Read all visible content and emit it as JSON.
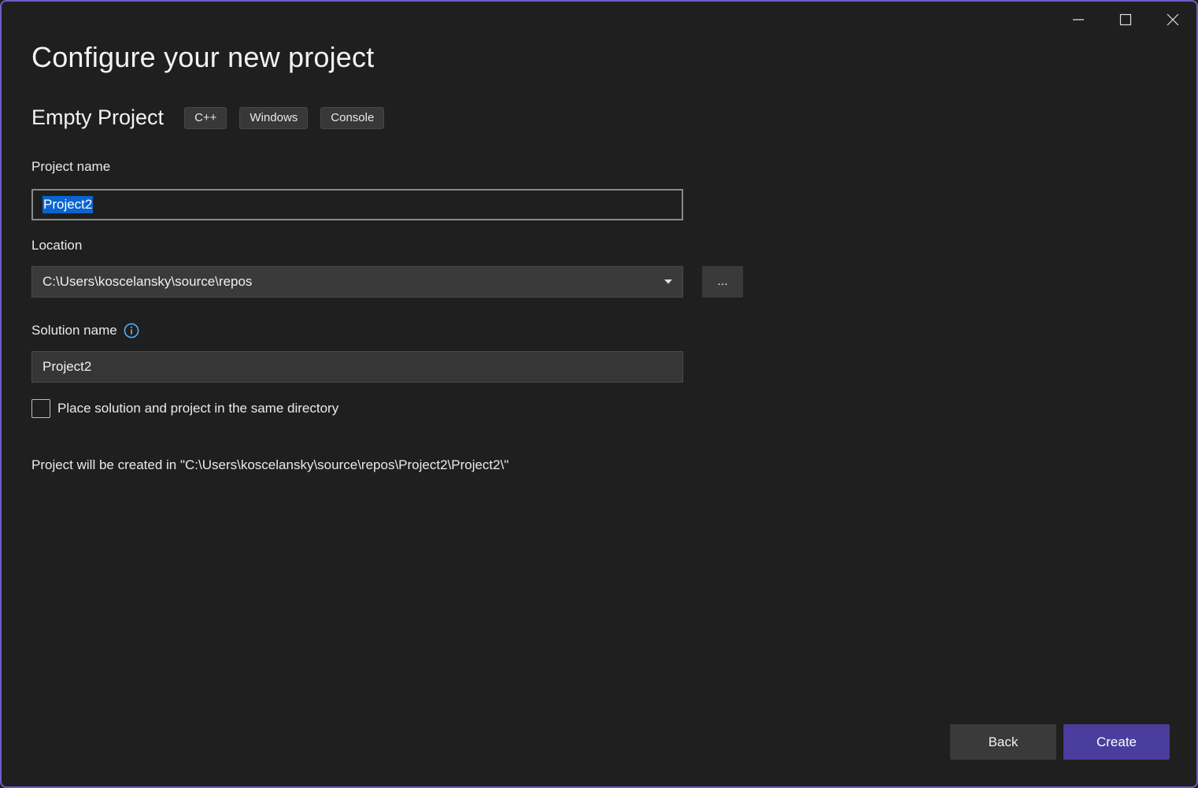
{
  "window": {
    "accent_color": "#6b5fc9",
    "caption_icons": [
      "minimize-icon",
      "maximize-icon",
      "close-icon"
    ]
  },
  "page": {
    "title": "Configure your new project"
  },
  "template": {
    "name": "Empty Project",
    "tags": [
      "C++",
      "Windows",
      "Console"
    ]
  },
  "project_name": {
    "label": "Project name",
    "value": "Project2"
  },
  "location": {
    "label": "Location",
    "value": "C:\\Users\\koscelansky\\source\\repos",
    "browse_label": "..."
  },
  "solution_name": {
    "label": "Solution name",
    "value": "Project2",
    "info_icon": "info-icon"
  },
  "same_directory": {
    "label": "Place solution and project in the same directory",
    "checked": false
  },
  "path_preview": {
    "text": "Project will be created in \"C:\\Users\\koscelansky\\source\\repos\\Project2\\Project2\\\""
  },
  "footer": {
    "back_label": "Back",
    "create_label": "Create",
    "create_color": "#4a3d9e"
  }
}
